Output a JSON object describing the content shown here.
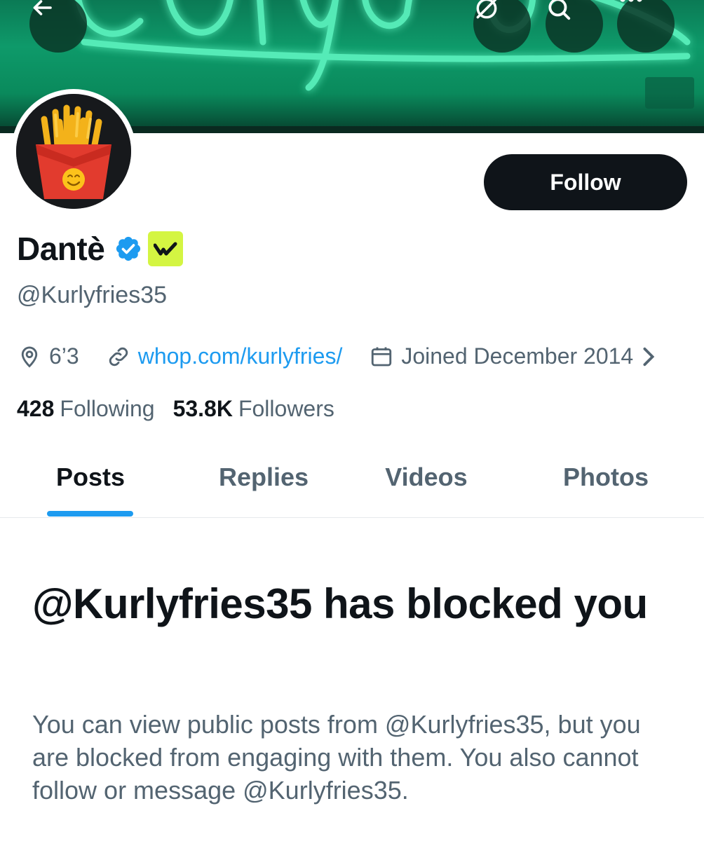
{
  "header": {
    "banner_text": "Kurlyfries",
    "back_icon": "arrow-left-icon",
    "mute_icon": "muted-circle-icon",
    "search_icon": "search-icon",
    "more_icon": "more-horizontal-icon"
  },
  "profile": {
    "display_name": "Dantè",
    "handle": "@Kurlyfries35",
    "follow_label": "Follow",
    "location": "6’3",
    "website": "whop.com/kurlyfries/",
    "joined": "Joined December 2014",
    "following_count": "428",
    "following_label": "Following",
    "followers_count": "53.8K",
    "followers_label": "Followers"
  },
  "tabs": [
    {
      "label": "Posts",
      "active": true
    },
    {
      "label": "Replies",
      "active": false
    },
    {
      "label": "Videos",
      "active": false
    },
    {
      "label": "Photos",
      "active": false
    }
  ],
  "blocked": {
    "title": "@Kurlyfries35 has blocked you",
    "description": "You can view public posts from @Kurlyfries35, but you are blocked from engaging with them. You also cannot follow or message @Kurlyfries35."
  },
  "colors": {
    "accent": "#1d9bf0",
    "verified": "#1d9bf0",
    "affiliate_badge_bg": "#d4f542",
    "text_primary": "#0f1419",
    "text_secondary": "#536471"
  }
}
